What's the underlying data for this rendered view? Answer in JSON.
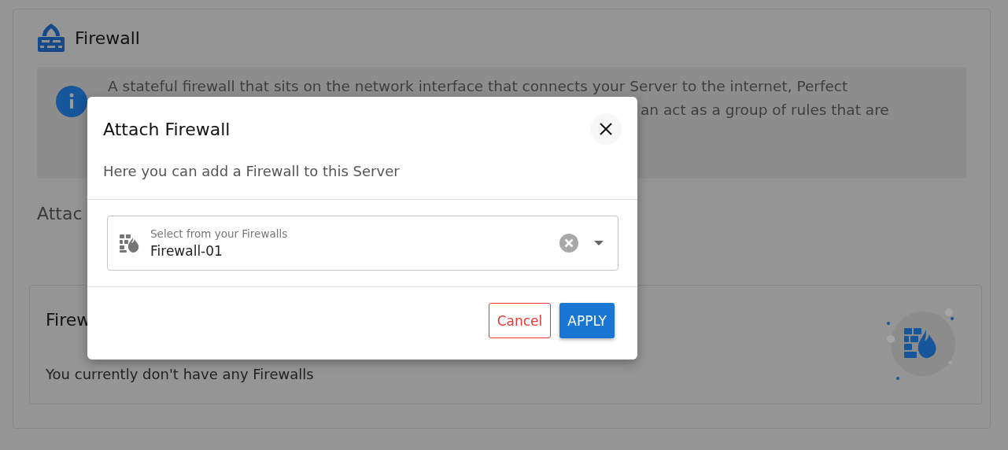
{
  "page": {
    "title": "Firewall",
    "info": {
      "lines": [
        "A stateful firewall that sits on the network interface that connects your Server to the internet, Perfect",
        "an act as a group of rules that are"
      ]
    },
    "attached_heading": "Attac",
    "card": {
      "title": "Firew",
      "empty_message": "You currently don't have any Firewalls"
    }
  },
  "dialog": {
    "title": "Attach Firewall",
    "subtitle": "Here you can add a Firewall to this Server",
    "select": {
      "label": "Select from your Firewalls",
      "value": "Firewall-01"
    },
    "buttons": [
      {
        "label": "Cancel",
        "kind": "outlined"
      },
      {
        "label": "APPLY",
        "kind": "primary"
      }
    ]
  }
}
